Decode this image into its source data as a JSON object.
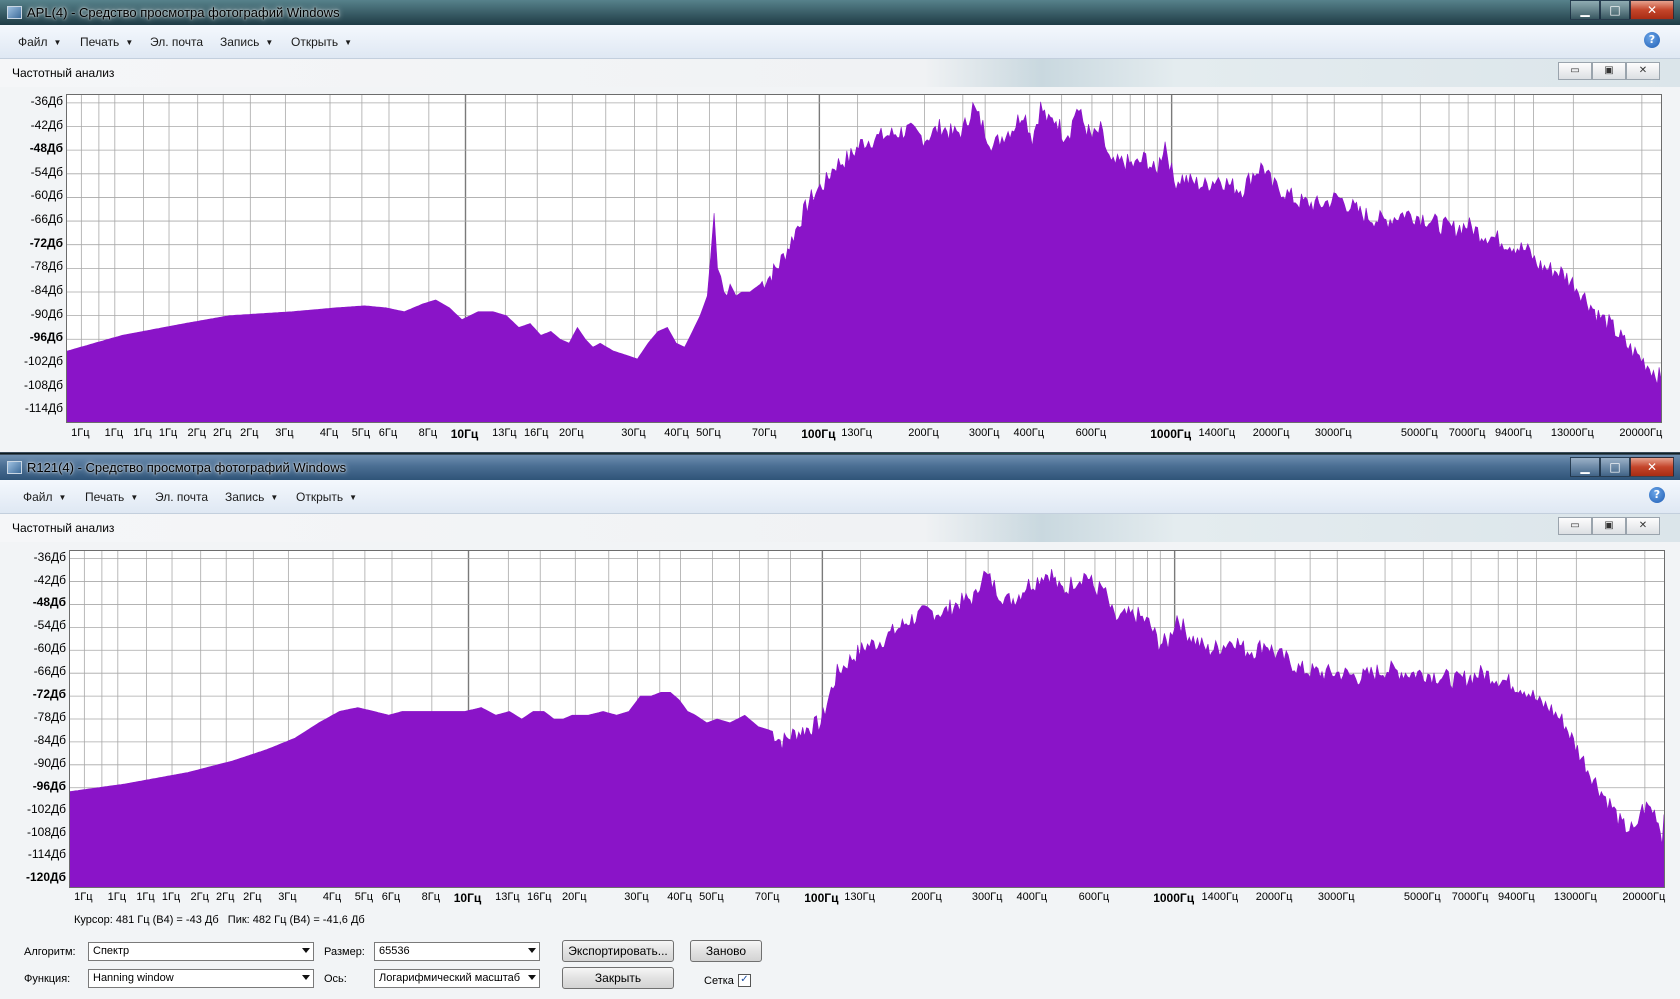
{
  "colors": {
    "spectrum_fill": "#8a14c8",
    "grid": "#a8a8a8",
    "grid_major": "#7a7a7a"
  },
  "axis": {
    "y_labels": [
      "-36Дб",
      "-42Дб",
      "-48Дб",
      "-54Дб",
      "-60Дб",
      "-66Дб",
      "-72Дб",
      "-78Дб",
      "-84Дб",
      "-90Дб",
      "-96Дб",
      "-102Дб",
      "-108Дб",
      "-114Дб",
      "-120Дб"
    ],
    "y_major": [
      "-48Дб",
      "-72Дб",
      "-96Дб",
      "-120Дб"
    ],
    "x_labels": [
      "1Гц",
      "1Гц",
      "1Гц",
      "1Гц",
      "2Гц",
      "2Гц",
      "2Гц",
      "3Гц",
      "4Гц",
      "5Гц",
      "6Гц",
      "8Гц",
      "10Гц",
      "13Гц",
      "16Гц",
      "20Гц",
      "30Гц",
      "40Гц",
      "50Гц",
      "70Гц",
      "100Гц",
      "130Гц",
      "200Гц",
      "300Гц",
      "400Гц",
      "600Гц",
      "1000Гц",
      "1400Гц",
      "2000Гц",
      "3000Гц",
      "5000Гц",
      "7000Гц",
      "9400Гц",
      "13000Гц",
      "20000Гц"
    ],
    "x_major": [
      "10Гц",
      "100Гц",
      "1000Гц"
    ]
  },
  "windows": [
    {
      "title": "APL(4) - Средство просмотра фотографий Windows",
      "menu": [
        {
          "label": "Файл",
          "arrow": "▼"
        },
        {
          "label": "Печать",
          "arrow": "▼"
        },
        {
          "label": "Эл. почта",
          "arrow": ""
        },
        {
          "label": "Запись",
          "arrow": "▼"
        },
        {
          "label": "Открыть",
          "arrow": "▼"
        }
      ],
      "help": "?",
      "panel_title": "Частотный анализ",
      "caption": {
        "min": "▁",
        "max": "□",
        "close": "✕"
      },
      "chart_data": {
        "type": "area",
        "xscale": "log",
        "xlim": [
          0.7,
          21000
        ],
        "ylim": [
          -117,
          -34
        ],
        "x": [
          0.7,
          1.0,
          1.5,
          2.0,
          3.0,
          4.0,
          4.8,
          5.5,
          6.2,
          7.0,
          7.6,
          8.3,
          9.0,
          10.0,
          11,
          12,
          13,
          14,
          15,
          16,
          17,
          18,
          19,
          20,
          21,
          22,
          24,
          26,
          28,
          30,
          32,
          34,
          36,
          38,
          40,
          42,
          44,
          45,
          46,
          47,
          48,
          49,
          50,
          51,
          53,
          55,
          58,
          62,
          66,
          70,
          75,
          80,
          85,
          90,
          95,
          100,
          110,
          120,
          130,
          145,
          160,
          180,
          200,
          215,
          230,
          245,
          255,
          265,
          280,
          300,
          320,
          340,
          360,
          380,
          400,
          420,
          440,
          460,
          480,
          500,
          530,
          560,
          600,
          650,
          700,
          750,
          800,
          850,
          900,
          950,
          1000,
          1100,
          1200,
          1300,
          1400,
          1500,
          1600,
          1700,
          1800,
          2000,
          2300,
          2600,
          2900,
          3000,
          3200,
          3500,
          4000,
          4500,
          5000,
          5500,
          6000,
          6500,
          7000,
          7500,
          8000,
          8500,
          9000,
          9400,
          10000,
          11000,
          12000,
          13000,
          14000,
          15000,
          16000,
          17000,
          18000,
          19000,
          20000,
          21000
        ],
        "y": [
          -99,
          -95,
          -92,
          -90,
          -89,
          -88,
          -87.5,
          -88,
          -89,
          -87,
          -86,
          -88,
          -91,
          -89,
          -89,
          -90,
          -93,
          -92,
          -95,
          -94,
          -96,
          -97,
          -93,
          -96,
          -98,
          -97,
          -99,
          -100,
          -101,
          -97,
          -94,
          -93,
          -97,
          -98,
          -94,
          -90,
          -85,
          -75,
          -64,
          -78,
          -80,
          -84,
          -85,
          -82,
          -85,
          -84,
          -84,
          -82,
          -80,
          -77,
          -72,
          -66,
          -61,
          -58,
          -56,
          -52,
          -50,
          -46,
          -45,
          -44,
          -43,
          -45,
          -42,
          -44,
          -43,
          -37,
          -40,
          -43,
          -47,
          -44,
          -42,
          -38,
          -45,
          -37,
          -41,
          -40,
          -44,
          -43,
          -37,
          -41,
          -45,
          -43,
          -52,
          -51,
          -52,
          -50,
          -54,
          -46,
          -56,
          -55,
          -56,
          -57,
          -55,
          -57,
          -58,
          -54,
          -52,
          -57,
          -58,
          -61,
          -62,
          -60,
          -63,
          -64,
          -65,
          -66,
          -64,
          -65,
          -67,
          -68,
          -67,
          -69,
          -70,
          -71,
          -72,
          -73,
          -74,
          -77,
          -78,
          -79,
          -82,
          -86,
          -90,
          -92,
          -95,
          -98,
          -100,
          -102,
          -104,
          -106,
          -106
        ]
      }
    },
    {
      "title": "R121(4) - Средство просмотра фотографий Windows",
      "menu": [
        {
          "label": "Файл",
          "arrow": "▼"
        },
        {
          "label": "Печать",
          "arrow": "▼"
        },
        {
          "label": "Эл. почта",
          "arrow": ""
        },
        {
          "label": "Запись",
          "arrow": "▼"
        },
        {
          "label": "Открыть",
          "arrow": "▼"
        }
      ],
      "help": "?",
      "panel_title": "Частотный анализ",
      "caption": {
        "min": "▁",
        "max": "□",
        "close": "✕"
      },
      "chart_data": {
        "type": "area",
        "xscale": "log",
        "xlim": [
          0.7,
          21000
        ],
        "ylim": [
          -122,
          -34
        ],
        "x": [
          0.7,
          1.0,
          1.5,
          2.0,
          2.5,
          3.0,
          3.5,
          4.0,
          4.5,
          5.0,
          5.5,
          6.0,
          7.0,
          8.0,
          9.0,
          10,
          11,
          12,
          13,
          14,
          15,
          16,
          17,
          18,
          20,
          22,
          24,
          26,
          28,
          30,
          32,
          34,
          36,
          38,
          40,
          43,
          46,
          50,
          55,
          60,
          65,
          70,
          75,
          80,
          85,
          90,
          95,
          100,
          110,
          120,
          130,
          145,
          160,
          180,
          200,
          215,
          230,
          245,
          255,
          265,
          280,
          300,
          320,
          340,
          360,
          380,
          400,
          420,
          440,
          460,
          480,
          500,
          530,
          560,
          600,
          650,
          700,
          750,
          800,
          850,
          900,
          950,
          1000,
          1100,
          1200,
          1300,
          1400,
          1500,
          1600,
          1700,
          1800,
          2000,
          2300,
          2600,
          2900,
          3000,
          3200,
          3500,
          4000,
          4500,
          5000,
          5500,
          6000,
          6500,
          7000,
          7500,
          8000,
          8500,
          9000,
          9400,
          10000,
          11000,
          12000,
          13000,
          14000,
          15000,
          16000,
          17000,
          17500,
          18000,
          19000,
          20000,
          21000
        ],
        "y": [
          -97,
          -95,
          -92,
          -89,
          -86,
          -83,
          -79,
          -76,
          -75,
          -76,
          -77,
          -76,
          -76,
          -76,
          -76,
          -75,
          -77,
          -76,
          -78,
          -76,
          -76,
          -78,
          -78,
          -77,
          -77,
          -76,
          -77,
          -76,
          -72,
          -72,
          -71,
          -71,
          -73,
          -76,
          -77,
          -79,
          -78,
          -79,
          -77,
          -80,
          -81,
          -84,
          -82,
          -81,
          -80,
          -79,
          -72,
          -66,
          -62,
          -59,
          -58,
          -55,
          -52,
          -50,
          -50,
          -48,
          -47,
          -46,
          -40,
          -41,
          -44,
          -47,
          -46,
          -43,
          -42,
          -40,
          -40,
          -44,
          -44,
          -42,
          -41,
          -40,
          -44,
          -44,
          -52,
          -51,
          -51,
          -53,
          -58,
          -58,
          -51,
          -55,
          -57,
          -60,
          -59,
          -57,
          -60,
          -60,
          -58,
          -61,
          -62,
          -65,
          -66,
          -66,
          -67,
          -67,
          -66,
          -65,
          -66,
          -66,
          -67,
          -68,
          -67,
          -66,
          -67,
          -68,
          -69,
          -70,
          -72,
          -74,
          -75,
          -79,
          -86,
          -92,
          -97,
          -101,
          -106,
          -107,
          -108,
          -102,
          -101,
          -103,
          -111,
          -116,
          -106,
          -103
        ]
      }
    }
  ],
  "status": {
    "cursor": "Курсор: 481 Гц (B4) = -43 Дб",
    "peak": "Пик: 482 Гц (B4) = -41,6 Дб"
  },
  "controls": {
    "algorithm_label": "Алгоритм:",
    "algorithm_value": "Спектр",
    "function_label": "Функция:",
    "function_value": "Hanning window",
    "size_label": "Размер:",
    "size_value": "65536",
    "axis_label": "Ось:",
    "axis_value": "Логарифмический масштаб",
    "export_button": "Экспортировать...",
    "redo_button": "Заново",
    "close_button": "Закрыть",
    "grid_label": "Сетка",
    "grid_checked": "✓"
  }
}
